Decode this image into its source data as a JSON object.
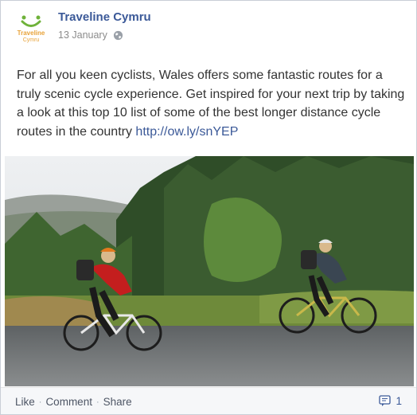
{
  "post": {
    "author": "Traveline Cymru",
    "date": "13 January",
    "logo_text_line1": "Traveline",
    "logo_text_line2": "Cymru",
    "message_text": "For all you keen cyclists, Wales offers some fantastic routes for a truly scenic cycle experience. Get inspired for your next trip by taking a look at this top 10 list of some of the best longer distance cycle routes in the country ",
    "link_text": "http://ow.ly/snYEP",
    "privacy_icon": "globe-icon"
  },
  "footer": {
    "like_label": "Like",
    "comment_label": "Comment",
    "share_label": "Share",
    "separator": "·",
    "comment_count": "1",
    "comment_icon": "comment-bubble-icon"
  },
  "colors": {
    "link": "#3b5998",
    "text": "#333333",
    "meta": "#8c8c8c",
    "footer_bg": "#f6f7f9"
  }
}
